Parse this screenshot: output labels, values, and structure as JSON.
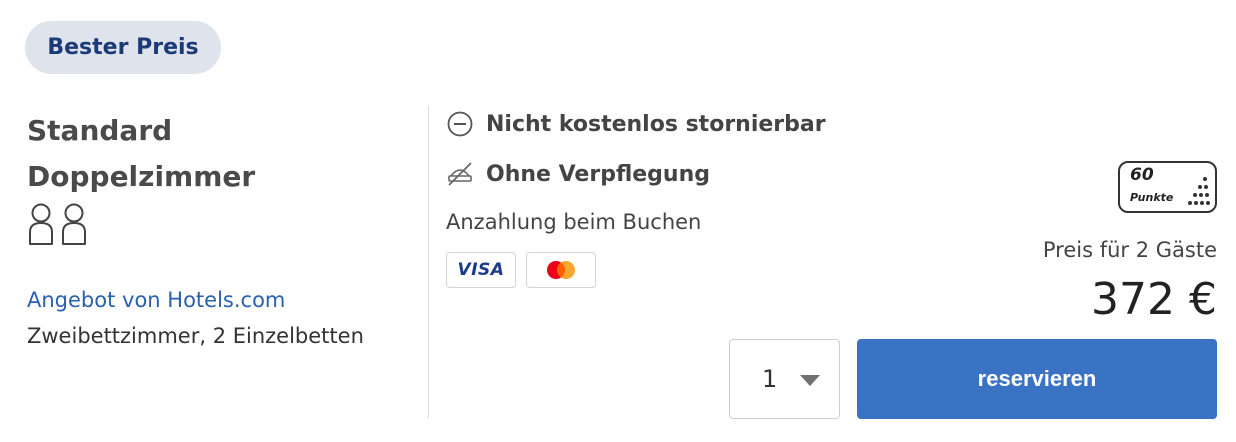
{
  "badge": {
    "label": "Bester Preis"
  },
  "room": {
    "title": "Standard Doppelzimmer",
    "guests_icon": "two-persons-icon",
    "provider_link": "Angebot von Hotels.com",
    "bed_info": "Zweibettzimmer, 2 Einzelbetten"
  },
  "features": [
    {
      "icon": "minus-circle-icon",
      "label": "Nicht kostenlos stornierbar"
    },
    {
      "icon": "no-meal-icon",
      "label": "Ohne Verpflegung"
    }
  ],
  "payment": {
    "deposit_text": "Anzahlung beim Buchen",
    "cards": [
      {
        "icon": "visa-icon",
        "label": "VISA"
      },
      {
        "icon": "mastercard-icon"
      }
    ]
  },
  "points": {
    "value": "60",
    "label": "Punkte"
  },
  "price": {
    "label": "Preis für 2 Gäste",
    "amount": "372 €"
  },
  "booking": {
    "quantity": "1",
    "reserve_label": "reservieren"
  },
  "colors": {
    "badge_bg": "#dfe3ec",
    "badge_text": "#1c3a78",
    "link": "#2a60b0",
    "button": "#3b73c4",
    "mc_red": "#eb001b",
    "mc_orange": "#f79e1b"
  }
}
